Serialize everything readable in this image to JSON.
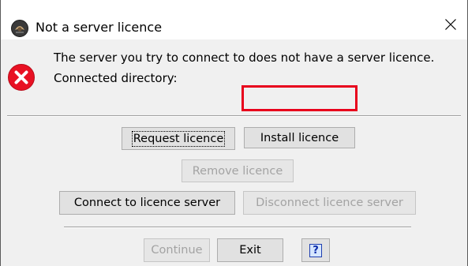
{
  "window": {
    "title": "Not a server licence",
    "close_icon": "close-icon",
    "app_icon": "app-logo-icon"
  },
  "message": {
    "icon": "error-icon",
    "line1": "The server you try to connect to does not have a server licence.",
    "line2": "Connected directory:"
  },
  "buttons": {
    "request_licence": "Request licence",
    "install_licence": "Install licence",
    "remove_licence": "Remove licence",
    "connect_server": "Connect to licence server",
    "disconnect_server": "Disconnect licence server",
    "continue": "Continue",
    "exit": "Exit",
    "help": "?"
  },
  "colors": {
    "highlight": "#e8001c",
    "error": "#e81123"
  }
}
